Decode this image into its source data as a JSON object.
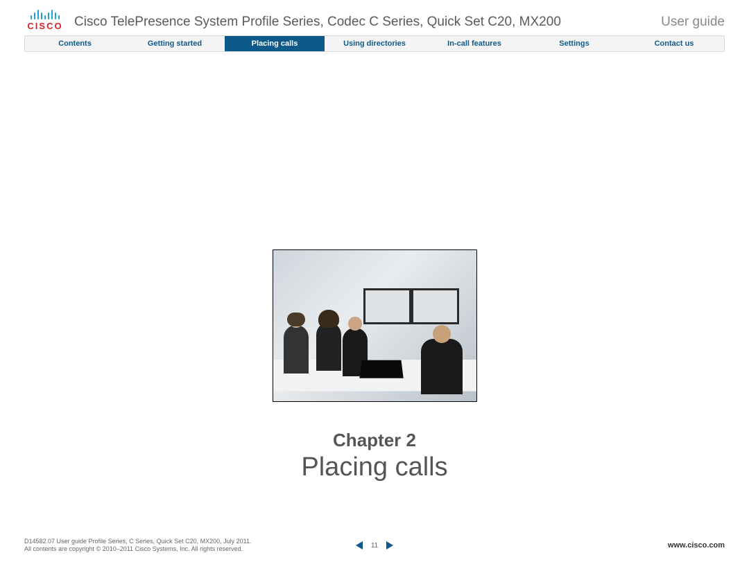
{
  "header": {
    "brand_word": "CISCO",
    "title": "Cisco TelePresence System Profile Series, Codec C Series, Quick Set C20, MX200",
    "doc_type": "User guide"
  },
  "nav": {
    "items": [
      {
        "label": "Contents",
        "active": false
      },
      {
        "label": "Getting started",
        "active": false
      },
      {
        "label": "Placing calls",
        "active": true
      },
      {
        "label": "Using directories",
        "active": false
      },
      {
        "label": "In-call features",
        "active": false
      },
      {
        "label": "Settings",
        "active": false
      },
      {
        "label": "Contact us",
        "active": false
      }
    ]
  },
  "chapter": {
    "label": "Chapter 2",
    "title": "Placing calls"
  },
  "footer": {
    "line1": "D14582.07 User guide Profile Series, C Series, Quick Set C20, MX200, July 2011.",
    "line2": "All contents are copyright © 2010–2011 Cisco Systems, Inc. All rights reserved.",
    "page": "11",
    "url": "www.cisco.com"
  }
}
